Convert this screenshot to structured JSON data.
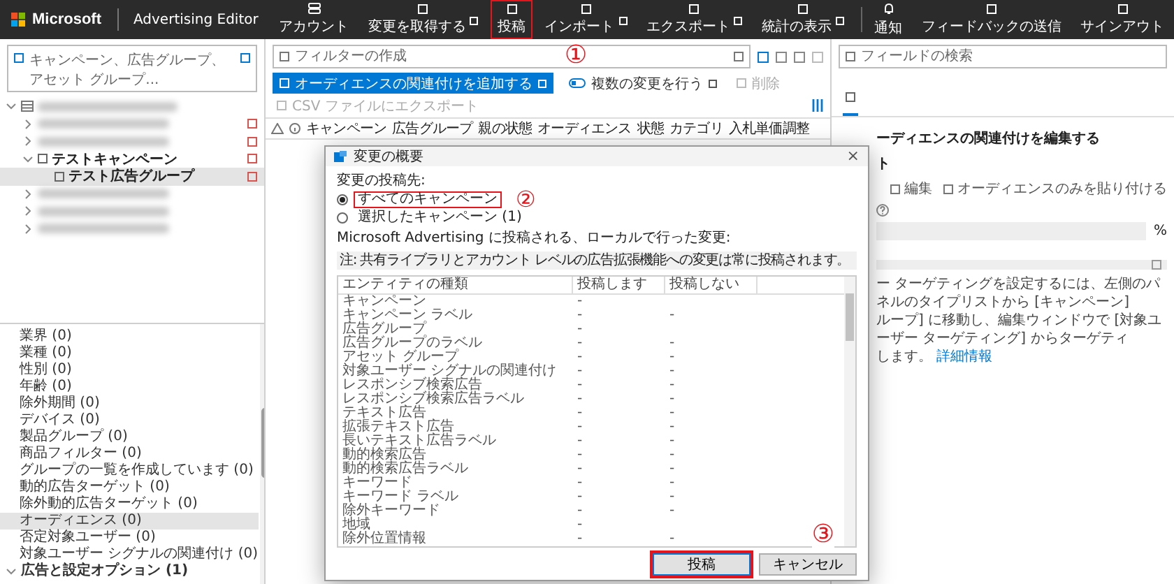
{
  "app": {
    "brand": "Microsoft",
    "product": "Advertising Editor"
  },
  "nav": [
    {
      "kind": "account",
      "label": "アカウント",
      "dropdown": false,
      "highlighted": false,
      "divider_before": false
    },
    {
      "kind": "command",
      "label": "変更を取得する",
      "dropdown": true,
      "highlighted": false,
      "divider_before": false
    },
    {
      "kind": "command",
      "label": "投稿",
      "dropdown": false,
      "highlighted": true,
      "divider_before": false
    },
    {
      "kind": "command",
      "label": "インポート",
      "dropdown": true,
      "highlighted": false,
      "divider_before": false
    },
    {
      "kind": "command",
      "label": "エクスポート",
      "dropdown": true,
      "highlighted": false,
      "divider_before": false
    },
    {
      "kind": "command",
      "label": "統計の表示",
      "dropdown": true,
      "highlighted": false,
      "divider_before": false
    },
    {
      "kind": "notifications",
      "label": "通知",
      "dropdown": false,
      "highlighted": false,
      "divider_before": true
    },
    {
      "kind": "command",
      "label": "フィードバックの送信",
      "dropdown": false,
      "highlighted": false,
      "divider_before": false
    },
    {
      "kind": "command",
      "label": "サインアウト",
      "dropdown": false,
      "highlighted": false,
      "divider_before": false
    }
  ],
  "tree": {
    "search_placeholder": "キャンペーン、広告グループ、アセット グループ...",
    "nodes": [
      {
        "blurred": true,
        "expanded": true,
        "flagged": false,
        "selected": false,
        "children": [
          {
            "blurred": true,
            "expanded": false,
            "flagged": true,
            "selected": false
          },
          {
            "blurred": true,
            "expanded": false,
            "flagged": true,
            "selected": false
          },
          {
            "label": "テストキャンペーン",
            "expanded": true,
            "flagged": true,
            "selected": false,
            "children": [
              {
                "label": "テスト広告グループ",
                "flagged": true,
                "selected": true
              }
            ]
          },
          {
            "blurred": true,
            "expanded": false,
            "flagged": false,
            "selected": false
          },
          {
            "blurred": true,
            "expanded": false,
            "flagged": false,
            "selected": false
          },
          {
            "blurred": true,
            "expanded": false,
            "flagged": false,
            "selected": false
          }
        ]
      }
    ]
  },
  "type_list": [
    {
      "kind": "item",
      "label": "業界 (0)",
      "selected": false
    },
    {
      "kind": "item",
      "label": "業種 (0)",
      "selected": false
    },
    {
      "kind": "item",
      "label": "性別 (0)",
      "selected": false
    },
    {
      "kind": "item",
      "label": "年齢 (0)",
      "selected": false
    },
    {
      "kind": "item",
      "label": "除外期間 (0)",
      "selected": false
    },
    {
      "kind": "item",
      "label": "デバイス (0)",
      "selected": false
    },
    {
      "kind": "item",
      "label": "製品グループ (0)",
      "selected": false
    },
    {
      "kind": "item",
      "label": "商品フィルター (0)",
      "selected": false
    },
    {
      "kind": "item",
      "label": "グループの一覧を作成しています (0)",
      "selected": false
    },
    {
      "kind": "item",
      "label": "動的広告ターゲット (0)",
      "selected": false
    },
    {
      "kind": "item",
      "label": "除外動的広告ターゲット (0)",
      "selected": false
    },
    {
      "kind": "item",
      "label": "オーディエンス (0)",
      "selected": true
    },
    {
      "kind": "item",
      "label": "否定対象ユーザー (0)",
      "selected": false
    },
    {
      "kind": "item",
      "label": "対象ユーザー シグナルの関連付け (0)",
      "selected": false
    },
    {
      "kind": "group",
      "label": "広告と設定オプション (1)",
      "selected": false,
      "expanded": true
    }
  ],
  "grid": {
    "filter_placeholder": "フィルターの作成",
    "toolbar": [
      {
        "kind": "primary",
        "label": "オーディエンスの関連付けを追加する",
        "disabled": false,
        "dropdown": true
      },
      {
        "kind": "multi",
        "label": "複数の変更を行う",
        "disabled": false,
        "dropdown": true
      },
      {
        "kind": "plain",
        "label": "削除",
        "disabled": true,
        "dropdown": false
      },
      {
        "kind": "plain",
        "label": "CSV ファイルにエクスポート",
        "disabled": true,
        "dropdown": false
      }
    ],
    "columns": [
      "キャンペーン",
      "広告グループ",
      "親の状態",
      "オーディエンス",
      "状態",
      "カテゴリ",
      "入札単価調整"
    ]
  },
  "properties": {
    "search_placeholder": "フィールドの検索",
    "tabs": [
      {
        "selected": true
      }
    ],
    "heading": "ーディエンスの関連付けを編集する",
    "subheading": "ト",
    "options": [
      {
        "label": "編集",
        "checked": false
      },
      {
        "label": "オーディエンスのみを貼り付ける",
        "checked": false
      }
    ],
    "bid_suffix": "%",
    "note_lines": [
      "ー ターゲティングを設定するには、左側のパネルのタイプリストから [キャンペーン]",
      "ループ] に移動し、編集ウィンドウで [対象ユーザー ターゲティング] からターゲティ",
      "します。"
    ],
    "link": "詳細情報"
  },
  "dialog": {
    "title": "変更の概要",
    "close": "×",
    "target_label": "変更の投稿先:",
    "targets": [
      {
        "label": "すべてのキャンペーン",
        "selected": true,
        "highlighted": true
      },
      {
        "label": "選択したキャンペーン (1)",
        "selected": false,
        "highlighted": false
      }
    ],
    "local_changes_label": "Microsoft Advertising に投稿される、ローカルで行った変更:",
    "note": "注: 共有ライブラリとアカウント レベルの広告拡張機能への変更は常に投稿されます。",
    "columns": [
      "エンティティの種類",
      "投稿します",
      "投稿しない"
    ],
    "rows": [
      {
        "entity": "キャンペーン",
        "post": "-"
      },
      {
        "entity": "キャンペーン ラベル",
        "post": "-",
        "skip": "-"
      },
      {
        "entity": "広告グループ",
        "post": "-"
      },
      {
        "entity": "広告グループのラベル",
        "post": "-",
        "skip": "-"
      },
      {
        "entity": "アセット グループ",
        "post": "-",
        "skip": "-"
      },
      {
        "entity": "対象ユーザー シグナルの関連付け",
        "post": "-",
        "skip": "-"
      },
      {
        "entity": "レスポンシブ検索広告",
        "post": "-",
        "skip": "-"
      },
      {
        "entity": "レスポンシブ検索広告ラベル",
        "post": "-",
        "skip": "-"
      },
      {
        "entity": "テキスト広告",
        "post": "-",
        "skip": "-"
      },
      {
        "entity": "拡張テキスト広告",
        "post": "-",
        "skip": "-"
      },
      {
        "entity": "長いテキスト広告ラベル",
        "post": "-",
        "skip": "-"
      },
      {
        "entity": "動的検索広告",
        "post": "-",
        "skip": "-"
      },
      {
        "entity": "動的検索広告ラベル",
        "post": "-",
        "skip": "-"
      },
      {
        "entity": "キーワード",
        "post": "-",
        "skip": "-"
      },
      {
        "entity": "キーワード ラベル",
        "post": "-",
        "skip": "-"
      },
      {
        "entity": "除外キーワード",
        "post": "-",
        "skip": "-"
      },
      {
        "entity": "地域",
        "post": "-"
      },
      {
        "entity": "除外位置情報",
        "post": "-",
        "skip": "-"
      }
    ],
    "buttons": [
      {
        "kind": "primary",
        "label": "投稿",
        "highlighted": true
      },
      {
        "kind": "secondary",
        "label": "キャンセル",
        "highlighted": false
      }
    ]
  },
  "callouts": [
    "①",
    "②",
    "③"
  ]
}
